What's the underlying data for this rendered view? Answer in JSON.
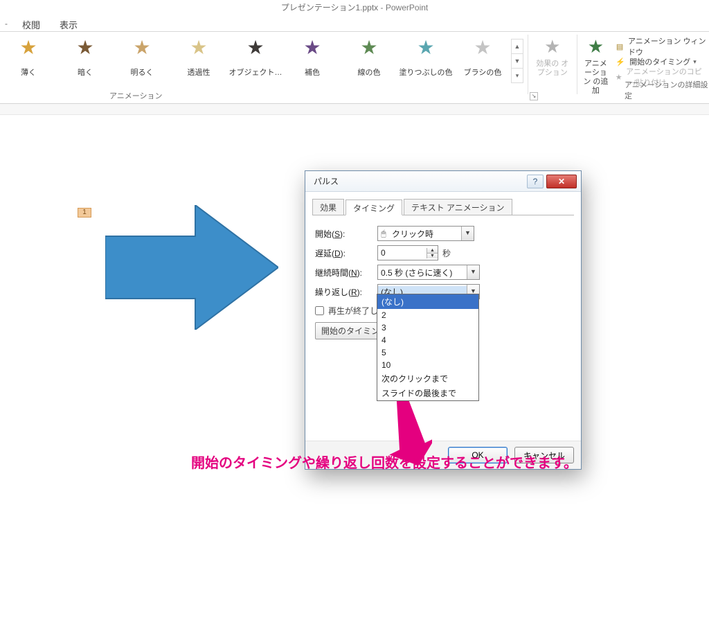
{
  "title": {
    "filename": "プレゼンテーション1.pptx",
    "app": "PowerPoint"
  },
  "tabstrip": {
    "review": "校閲",
    "view": "表示"
  },
  "gallery": {
    "group_label": "アニメーション",
    "items": [
      {
        "label": "薄く",
        "star": "gold"
      },
      {
        "label": "暗く",
        "star": "brown"
      },
      {
        "label": "明るく",
        "star": "tan"
      },
      {
        "label": "透過性",
        "star": "pale"
      },
      {
        "label": "オブジェクト…",
        "star": "dark"
      },
      {
        "label": "補色",
        "star": "purple"
      },
      {
        "label": "線の色",
        "star": "green"
      },
      {
        "label": "塗りつぶしの色",
        "star": "teal"
      },
      {
        "label": "ブラシの色",
        "star": "gray"
      }
    ]
  },
  "big_buttons": {
    "effect_options": "効果の\nオプション",
    "add_animation": "アニメーション\nの追加"
  },
  "advanced": {
    "pane": "アニメーション ウィンドウ",
    "trigger": "開始のタイミング",
    "painter": "アニメーションのコピー/貼り付け",
    "group_label": "アニメーションの詳細設定"
  },
  "anim_tag": "1",
  "dialog": {
    "title": "パルス",
    "tabs": {
      "effect": "効果",
      "timing": "タイミング",
      "text": "テキスト アニメーション"
    },
    "fields": {
      "start_label": "開始(S):",
      "start_value": "クリック時",
      "delay_label": "遅延(D):",
      "delay_value": "0",
      "delay_unit": "秒",
      "duration_label": "継続時間(N):",
      "duration_value": "0.5 秒 (さらに速く)",
      "repeat_label": "繰り返し(R):",
      "repeat_value": "(なし)",
      "rewind_label": "再生が終了したら巻き戻す(W)",
      "timing_button": "開始のタイミング"
    },
    "repeat_options": [
      "(なし)",
      "2",
      "3",
      "4",
      "5",
      "10",
      "次のクリックまで",
      "スライドの最後まで"
    ],
    "ok": "OK",
    "cancel": "キャンセル"
  },
  "caption": "開始のタイミングや繰り返し回数を設定することができます。"
}
